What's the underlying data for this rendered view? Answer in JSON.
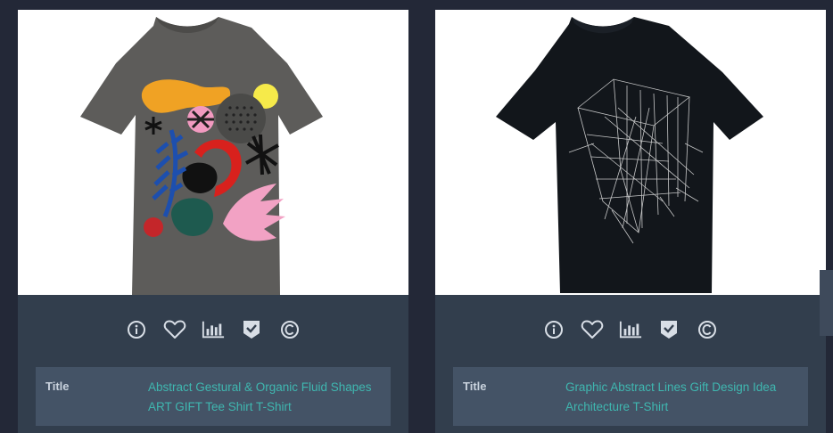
{
  "products": [
    {
      "image_name": "abstract-organic-shapes-tshirt",
      "shirt_color": "#5d5c5a",
      "icons": [
        "info-icon",
        "heart-icon",
        "bar-chart-icon",
        "badge-check-icon",
        "copyright-icon"
      ],
      "title_label": "Title",
      "title_value": "Abstract Gestural & Organic Fluid Shapes ART GIFT Tee Shirt T-Shirt"
    },
    {
      "image_name": "abstract-architecture-lines-tshirt",
      "shirt_color": "#12161b",
      "icons": [
        "info-icon",
        "heart-icon",
        "bar-chart-icon",
        "badge-check-icon",
        "copyright-icon"
      ],
      "title_label": "Title",
      "title_value": "Graphic Abstract Lines Gift Design Idea Architecture T-Shirt"
    }
  ],
  "colors": {
    "background": "#232837",
    "card": "#323e4d",
    "title_box": "#445366",
    "link": "#3fb7b0",
    "icon": "#d8dee6"
  }
}
